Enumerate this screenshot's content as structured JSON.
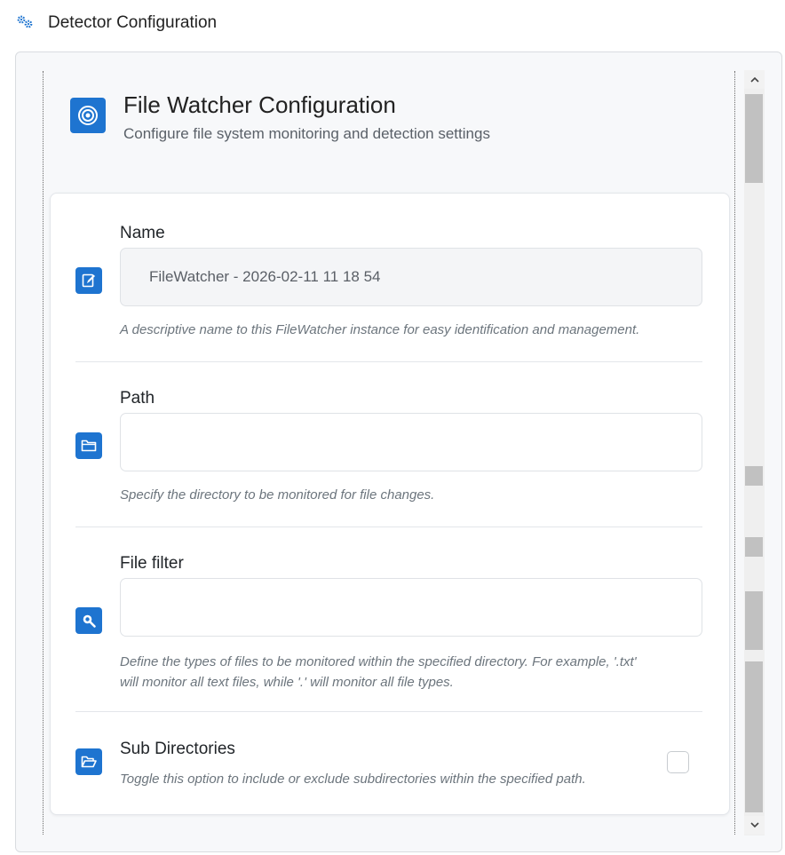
{
  "page": {
    "title": "Detector Configuration",
    "icon": "gears-icon"
  },
  "config_header": {
    "title": "File Watcher Configuration",
    "subtitle": "Configure file system monitoring and detection settings",
    "icon": "target-icon",
    "icon_color": "#1e74d0"
  },
  "fields": {
    "name": {
      "label": "Name",
      "value": "FileWatcher - 2026-02-11 11 18 54",
      "help": "A descriptive name to this FileWatcher instance for easy identification and management.",
      "icon": "edit-icon"
    },
    "path": {
      "label": "Path",
      "value": "",
      "help": "Specify the directory to be monitored for file changes.",
      "icon": "folder-icon"
    },
    "file_filter": {
      "label": "File filter",
      "value": "",
      "help_line1": "Define the types of files to be monitored within the specified directory.  For example, '.txt'",
      "help_line2": "will monitor all text files, while '.' will monitor all file types.",
      "icon": "search-icon"
    },
    "sub_directories": {
      "label": "Sub Directories",
      "help": "Toggle this option to include or exclude subdirectories within the specified path.",
      "checked": false,
      "icon": "folder-open-icon"
    }
  },
  "colors": {
    "accent": "#1e74d0",
    "panel_bg": "#f7f8fa",
    "scrollbar_thumb": "#c1c1c1"
  }
}
